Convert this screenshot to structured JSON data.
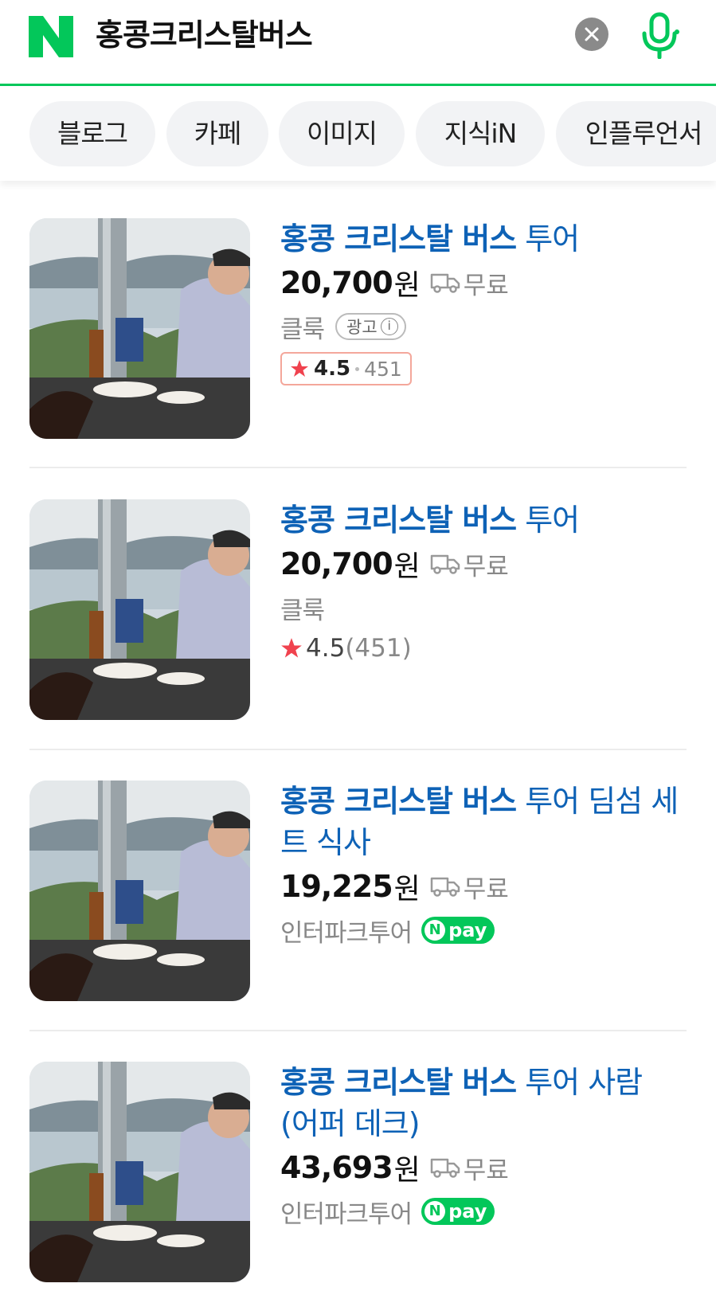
{
  "header": {
    "logo_letter": "N",
    "query": "홍콩크리스탈버스"
  },
  "tabs": [
    "블로그",
    "카페",
    "이미지",
    "지식iN",
    "인플루언서"
  ],
  "items": [
    {
      "title_highlight": "홍콩 크리스탈 버스",
      "title_rest": " 투어",
      "price": "20,700",
      "currency": "원",
      "shipping": "무료",
      "seller": "클룩",
      "ad_label": "광고",
      "rating": "4.5",
      "review_count": "451"
    },
    {
      "title_highlight": "홍콩 크리스탈 버스",
      "title_rest": " 투어",
      "price": "20,700",
      "currency": "원",
      "shipping": "무료",
      "seller": "클룩",
      "rating": "4.5",
      "review_count": "(451)"
    },
    {
      "title_highlight": "홍콩 크리스탈 버스",
      "title_rest": " 투어 딤섬 세트 식사",
      "price": "19,225",
      "currency": "원",
      "shipping": "무료",
      "seller": "인터파크투어",
      "pay_badge": "pay"
    },
    {
      "title_highlight": "홍콩 크리스탈 버스",
      "title_rest": " 투어 사람 (어퍼 데크)",
      "price": "43,693",
      "currency": "원",
      "shipping": "무료",
      "seller": "인터파크투어",
      "pay_badge": "pay"
    }
  ],
  "colors": {
    "brand_green": "#03c75a",
    "title_blue": "#0e62b6",
    "star_red": "#f0424e"
  },
  "icons": [
    "naver-logo-icon",
    "clear-icon",
    "microphone-icon",
    "truck-icon",
    "star-icon",
    "info-icon",
    "npay-icon"
  ]
}
